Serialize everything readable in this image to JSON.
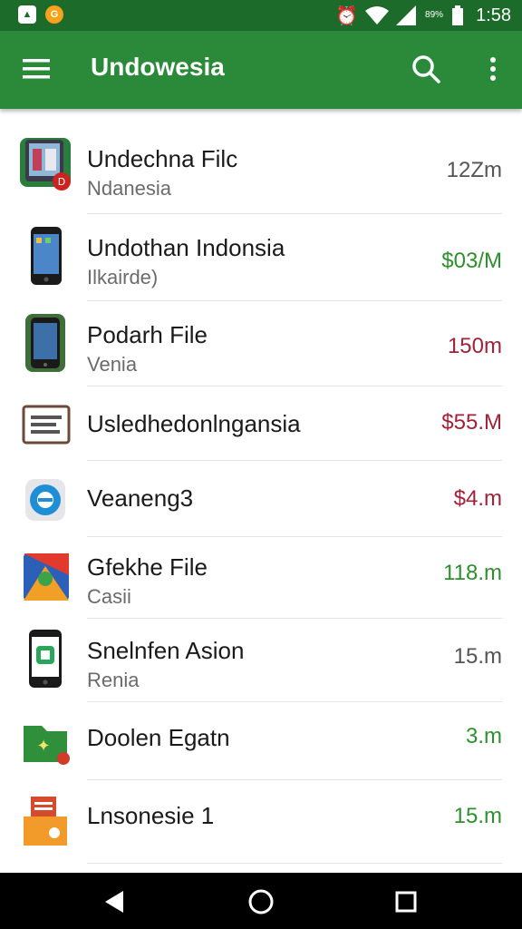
{
  "status_bar": {
    "time": "1:58",
    "battery_text": "89%",
    "icons": [
      "image-notification-icon",
      "app-notification-icon",
      "alarm-icon",
      "wifi-icon",
      "signal-icon",
      "battery-icon"
    ]
  },
  "app_bar": {
    "title": "Undowesia",
    "color": "#2a8a3a",
    "icons": [
      "menu-icon",
      "search-icon",
      "more-vert-icon"
    ]
  },
  "files": [
    {
      "title": "Undechna Filc",
      "subtitle": "Ndanesia",
      "size": "12Zm",
      "size_color": "#555555",
      "icon": "tablet-app-icon"
    },
    {
      "title": "Undothan Indonsia",
      "subtitle": "Ilkairde)",
      "size": "$03/M",
      "size_color": "#2f8f2f",
      "icon": "phone-icon"
    },
    {
      "title": "Podarh File",
      "subtitle": "Venia",
      "size": "150m",
      "size_color": "#a0223a",
      "icon": "phone-case-icon"
    },
    {
      "title": "Usledhedonlngansia",
      "subtitle": "",
      "size": "$55.M",
      "size_color": "#a0223a",
      "icon": "document-icon"
    },
    {
      "title": "Veaneng3",
      "subtitle": "",
      "size": "$4.m",
      "size_color": "#a0223a",
      "icon": "circle-app-icon"
    },
    {
      "title": "Gfekhe File",
      "subtitle": "Casii",
      "size": "118.m",
      "size_color": "#2f8f2f",
      "icon": "colorful-app-icon"
    },
    {
      "title": "Snelnfen Asion",
      "subtitle": "Renia",
      "size": "15.m",
      "size_color": "#555555",
      "icon": "phone-app-icon"
    },
    {
      "title": "Doolen Egatn",
      "subtitle": "",
      "size": "3.m",
      "size_color": "#2f8f2f",
      "icon": "green-folder-icon"
    },
    {
      "title": "Lnsonesie 1",
      "subtitle": "",
      "size": "15.m",
      "size_color": "#2f8f2f",
      "icon": "orange-folder-icon"
    }
  ],
  "nav_bar": {
    "buttons": [
      "back-icon",
      "home-icon",
      "recents-icon"
    ]
  }
}
